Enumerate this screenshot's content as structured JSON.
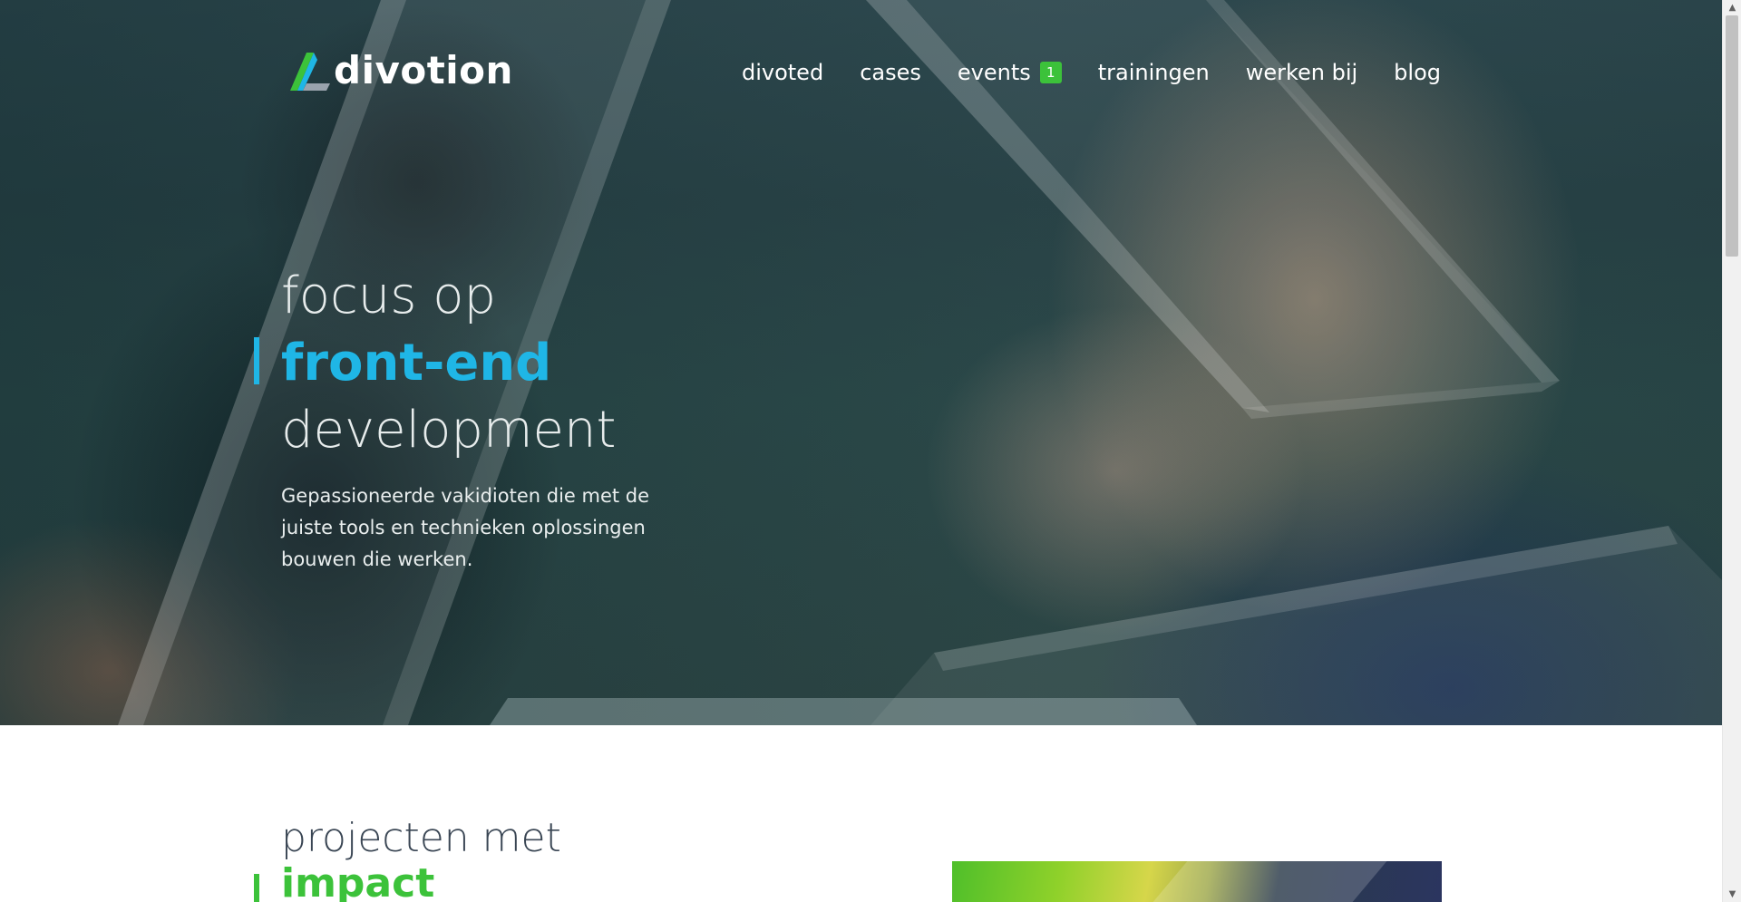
{
  "brand": {
    "name": "divotion",
    "logo_icon": "divotion-triangle-logo"
  },
  "nav": {
    "items": [
      {
        "label": "divoted"
      },
      {
        "label": "cases"
      },
      {
        "label": "events",
        "badge": "1"
      },
      {
        "label": "trainingen"
      },
      {
        "label": "werken bij"
      },
      {
        "label": "blog"
      }
    ]
  },
  "hero": {
    "line1": "focus op",
    "line2": "front-end",
    "line3": "development",
    "subtitle": "Gepassioneerde vakidioten die met de juiste tools en technieken oplossingen bouwen die werken."
  },
  "projects": {
    "line1": "projecten met",
    "line2": "impact"
  },
  "colors": {
    "accent_blue": "#1fb6e6",
    "accent_green": "#3cc23a",
    "badge_green": "#3cc23a",
    "heading_dark": "#3a4654"
  },
  "scrollbar": {
    "up_icon": "triangle-up-icon",
    "down_icon": "triangle-down-icon"
  }
}
